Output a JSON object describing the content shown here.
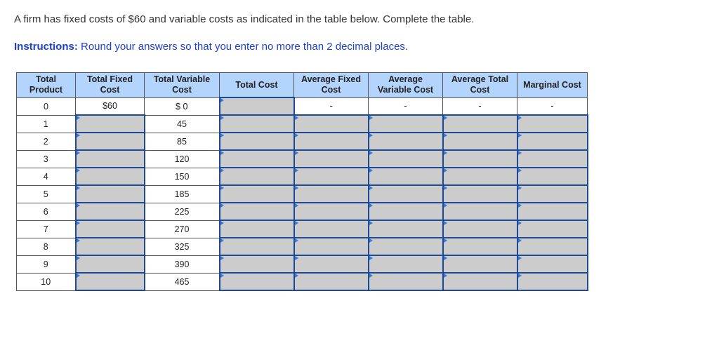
{
  "question": "A firm has fixed costs of $60 and variable costs as indicated in the table below. Complete the table.",
  "instructions": {
    "label": "Instructions:",
    "text": " Round your answers so that you enter no more than 2 decimal places."
  },
  "table": {
    "headers": [
      [
        "Total",
        "Product"
      ],
      [
        "Total Fixed",
        "Cost"
      ],
      [
        "Total Variable",
        "Cost"
      ],
      [
        "Total Cost",
        ""
      ],
      [
        "Average Fixed",
        "Cost"
      ],
      [
        "Average",
        "Variable Cost"
      ],
      [
        "Average Total",
        "Cost"
      ],
      [
        "Marginal Cost",
        ""
      ]
    ],
    "rows": [
      [
        "0",
        "$60",
        "$ 0",
        null,
        "-",
        "-",
        "-",
        "-"
      ],
      [
        "1",
        null,
        "45",
        null,
        null,
        null,
        null,
        null
      ],
      [
        "2",
        null,
        "85",
        null,
        null,
        null,
        null,
        null
      ],
      [
        "3",
        null,
        "120",
        null,
        null,
        null,
        null,
        null
      ],
      [
        "4",
        null,
        "150",
        null,
        null,
        null,
        null,
        null
      ],
      [
        "5",
        null,
        "185",
        null,
        null,
        null,
        null,
        null
      ],
      [
        "6",
        null,
        "225",
        null,
        null,
        null,
        null,
        null
      ],
      [
        "7",
        null,
        "270",
        null,
        null,
        null,
        null,
        null
      ],
      [
        "8",
        null,
        "325",
        null,
        null,
        null,
        null,
        null
      ],
      [
        "9",
        null,
        "390",
        null,
        null,
        null,
        null,
        null
      ],
      [
        "10",
        null,
        "465",
        null,
        null,
        null,
        null,
        null
      ]
    ]
  }
}
